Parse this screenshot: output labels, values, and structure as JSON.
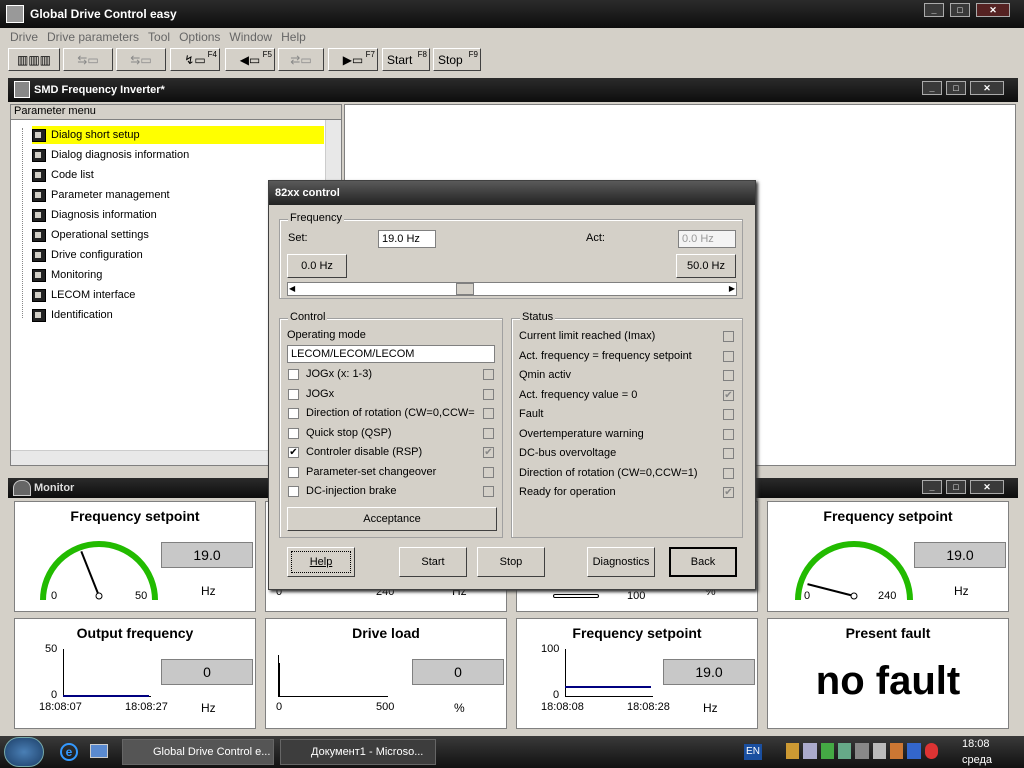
{
  "app": {
    "title": "Global Drive Control easy"
  },
  "menu": [
    "Drive",
    "Drive parameters",
    "Tool",
    "Options",
    "Window",
    "Help"
  ],
  "toolbar": {
    "f4": "F4",
    "f5": "F5",
    "f7": "F7",
    "start_label": "Start",
    "start_key": "F8",
    "stop_label": "Stop",
    "stop_key": "F9"
  },
  "inner_window": {
    "title": "SMD Frequency Inverter*",
    "menu_header": "Parameter menu"
  },
  "tree": [
    "Dialog short setup",
    "Dialog diagnosis information",
    "Code list",
    "Parameter management",
    "Diagnosis information",
    "Operational settings",
    "Drive configuration",
    "Monitoring",
    "LECOM interface",
    "Identification"
  ],
  "monitor": {
    "title": "Monitor",
    "p1": {
      "title": "Frequency setpoint",
      "min": "0",
      "max": "50",
      "value": "19.0",
      "unit": "Hz",
      "level": 0.38
    },
    "p2": {
      "min": "0",
      "max": "240",
      "unit": "Hz"
    },
    "p3": {
      "max": "100",
      "unit": "%"
    },
    "p4": {
      "title": "Frequency setpoint",
      "min": "0",
      "max": "240",
      "value": "19.0",
      "unit": "Hz",
      "level": 0.08
    },
    "p5": {
      "title": "Output frequency",
      "ymax": "50",
      "ymin": "0",
      "t0": "18:08:07",
      "t1": "18:08:27",
      "value": "0",
      "unit": "Hz"
    },
    "p6": {
      "title": "Drive load",
      "xmin": "0",
      "xmax": "500",
      "value": "0",
      "unit": "%"
    },
    "p7": {
      "title": "Frequency setpoint",
      "ymax": "100",
      "ymin": "0",
      "t0": "18:08:08",
      "t1": "18:08:28",
      "value": "19.0",
      "unit": "Hz"
    },
    "p8": {
      "title": "Present fault",
      "value": "no fault"
    }
  },
  "dialog": {
    "title": "82xx control",
    "frequency": {
      "group": "Frequency",
      "set_label": "Set:",
      "set_value": "19.0 Hz",
      "act_label": "Act:",
      "act_value": "0.0 Hz",
      "min_button": "0.0 Hz",
      "max_button": "50.0 Hz",
      "slider_level": 0.38
    },
    "control": {
      "group": "Control",
      "mode_label": "Operating mode",
      "mode_value": "LECOM/LECOM/LECOM",
      "items": [
        {
          "label": "JOGx (x: 1-3)",
          "checked": false,
          "status": false
        },
        {
          "label": "JOGx",
          "checked": false,
          "status": false
        },
        {
          "label": "Direction of rotation (CW=0,CCW=",
          "checked": false,
          "status": false
        },
        {
          "label": "Quick stop (QSP)",
          "checked": false,
          "status": false
        },
        {
          "label": "Controler disable (RSP)",
          "checked": true,
          "status": true
        },
        {
          "label": "Parameter-set changeover",
          "checked": false,
          "status": false
        },
        {
          "label": "DC-injection brake",
          "checked": false,
          "status": false
        }
      ],
      "acceptance": "Acceptance"
    },
    "status": {
      "group": "Status",
      "items": [
        {
          "label": "Current limit reached (Imax)",
          "checked": false
        },
        {
          "label": "Act. frequency = frequency setpoint",
          "checked": false
        },
        {
          "label": "Qmin activ",
          "checked": false
        },
        {
          "label": "Act. frequency value = 0",
          "checked": true
        },
        {
          "label": "Fault",
          "checked": false
        },
        {
          "label": "Overtemperature warning",
          "checked": false
        },
        {
          "label": "DC-bus overvoltage",
          "checked": false
        },
        {
          "label": "Direction of rotation (CW=0,CCW=1)",
          "checked": false
        },
        {
          "label": "Ready for operation",
          "checked": true
        }
      ]
    },
    "buttons": {
      "help": "Help",
      "start": "Start",
      "stop": "Stop",
      "diagnostics": "Diagnostics",
      "back": "Back"
    }
  },
  "taskbar": {
    "tasks": [
      "Global Drive Control e...",
      "Документ1 - Microso..."
    ],
    "lang": "EN",
    "time": "18:08",
    "day": "среда"
  },
  "colors": {
    "highlight": "#ffff00",
    "gauge": "#22bb00",
    "trend": "#000080"
  }
}
